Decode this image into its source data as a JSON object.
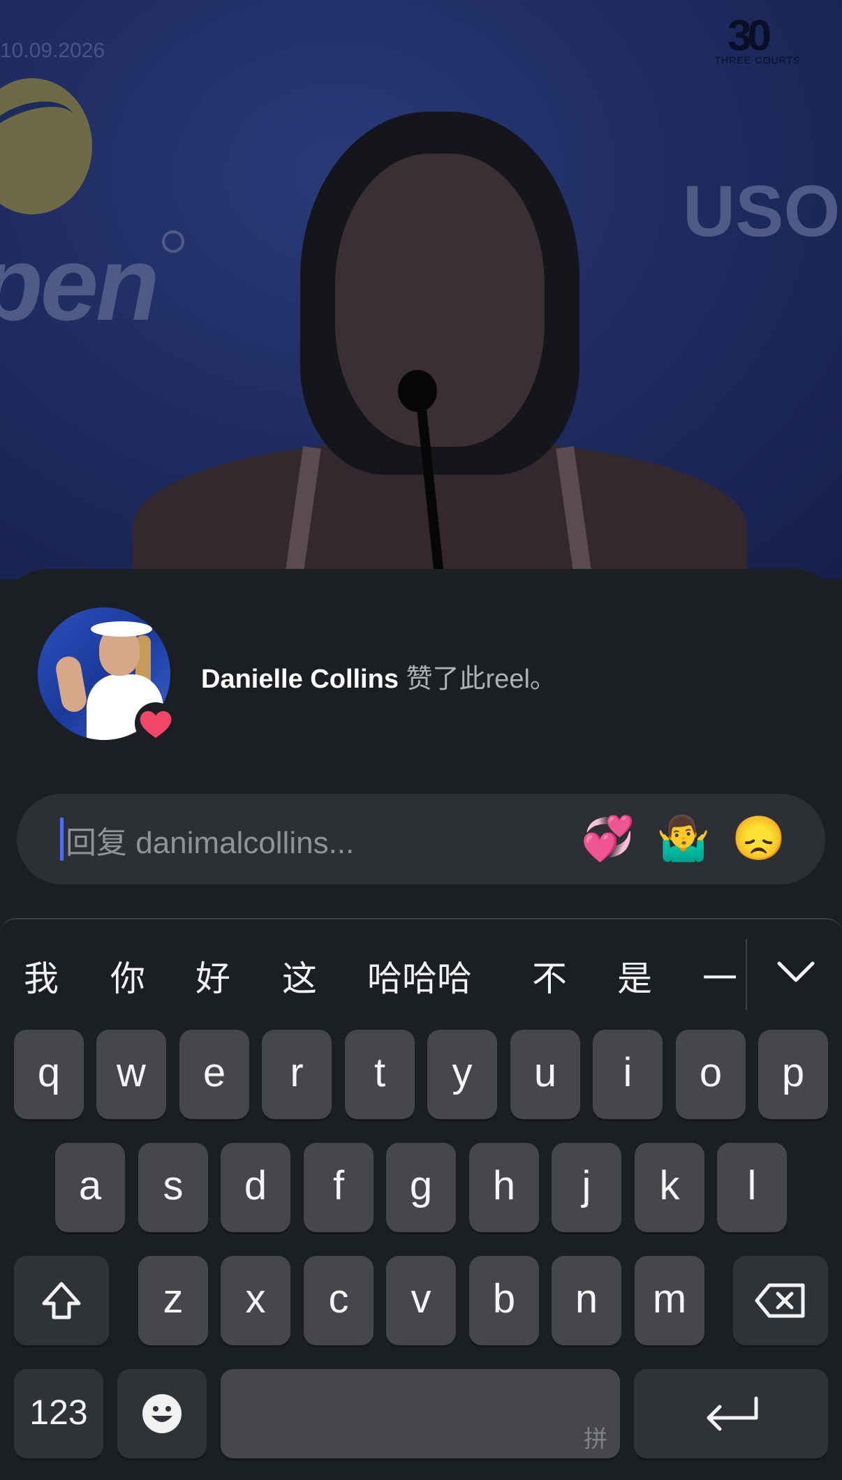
{
  "video": {
    "date_watermark": "10.09.2026",
    "logo_number": "30",
    "logo_subtitle": "THREE·COURTS",
    "banner_left": "pen",
    "banner_right": "USO"
  },
  "notification": {
    "user_name": "Danielle Collins",
    "action_text": "赞了此reel。",
    "reaction_icon": "heart-icon"
  },
  "reply": {
    "placeholder": "回复 danimalcollins...",
    "quick_emojis": [
      "💞",
      "🤷‍♂️",
      "😞"
    ]
  },
  "keyboard": {
    "candidates": [
      "我",
      "你",
      "好",
      "这",
      "哈哈哈",
      "不",
      "是",
      "一"
    ],
    "row1": [
      "q",
      "w",
      "e",
      "r",
      "t",
      "y",
      "u",
      "i",
      "o",
      "p"
    ],
    "row2": [
      "a",
      "s",
      "d",
      "f",
      "g",
      "h",
      "j",
      "k",
      "l"
    ],
    "row3": [
      "z",
      "x",
      "c",
      "v",
      "b",
      "n",
      "m"
    ],
    "numbers_label": "123",
    "space_hint": "拼",
    "icons": {
      "shift": "shift-icon",
      "delete": "backspace-icon",
      "emoji": "emoji-icon",
      "return": "return-icon",
      "collapse": "chevron-down-icon"
    }
  }
}
